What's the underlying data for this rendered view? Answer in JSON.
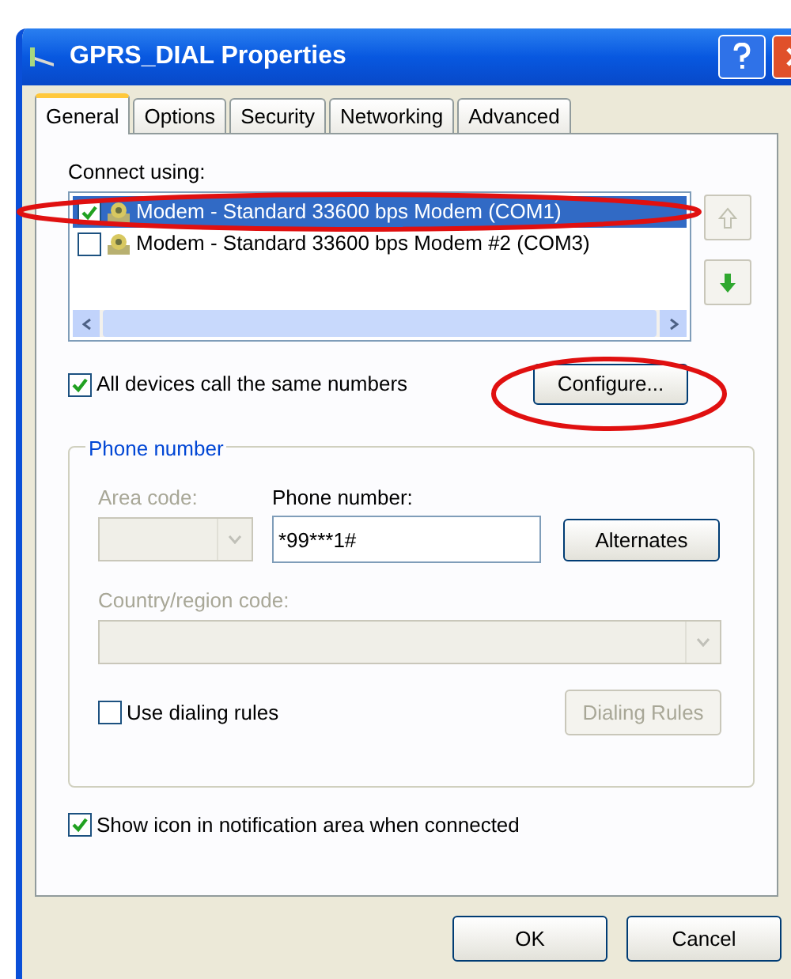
{
  "window": {
    "title": "GPRS_DIAL Properties"
  },
  "tabs": [
    {
      "label": "General",
      "selected": true
    },
    {
      "label": "Options",
      "selected": false
    },
    {
      "label": "Security",
      "selected": false
    },
    {
      "label": "Networking",
      "selected": false
    },
    {
      "label": "Advanced",
      "selected": false
    }
  ],
  "connect_using": {
    "label": "Connect using:",
    "devices": [
      {
        "name": "Modem - Standard 33600 bps Modem (COM1)",
        "checked": true,
        "selected": true
      },
      {
        "name": "Modem - Standard 33600 bps Modem #2 (COM3)",
        "checked": false,
        "selected": false
      }
    ]
  },
  "same_numbers": {
    "label": "All devices call the same numbers",
    "checked": true
  },
  "configure_button": "Configure...",
  "phone_group": {
    "title": "Phone number",
    "area_code": {
      "label": "Area code:",
      "disabled": true
    },
    "phone_number": {
      "label": "Phone number:",
      "value": "*99***1#"
    },
    "alternates_button": "Alternates",
    "country": {
      "label": "Country/region code:",
      "disabled": true
    },
    "use_dialing_rules": {
      "label": "Use dialing rules",
      "checked": false
    },
    "dialing_rules_button": {
      "label": "Dialing Rules",
      "disabled": true
    }
  },
  "show_icon": {
    "label": "Show icon in notification area when connected",
    "checked": true
  },
  "buttons": [
    "OK",
    "Cancel"
  ]
}
